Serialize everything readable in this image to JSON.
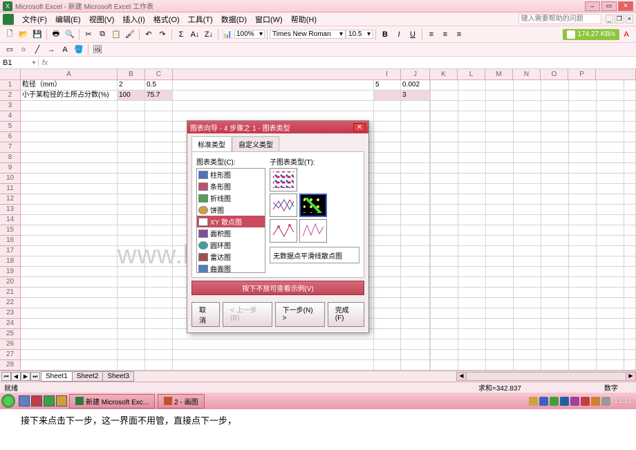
{
  "window": {
    "title": "Microsoft Excel - 新建 Microsoft Excel 工作表"
  },
  "menu": {
    "file": "文件(F)",
    "edit": "编辑(E)",
    "view": "视图(V)",
    "insert": "插入(I)",
    "format": "格式(O)",
    "tools": "工具(T)",
    "data": "数据(D)",
    "window": "窗口(W)",
    "help": "帮助(H)",
    "help_placeholder": "键入需要帮助的问题"
  },
  "toolbar": {
    "zoom": "100%",
    "font_name": "Times New Roman",
    "font_size": "10.5",
    "speed": "174.27 KB/s"
  },
  "namebox": {
    "ref": "B1"
  },
  "columns": [
    "A",
    "B",
    "C",
    "I",
    "J",
    "K",
    "L",
    "M",
    "N",
    "O",
    "P"
  ],
  "rows": {
    "r1": {
      "a": "粒径（mm）",
      "b": "2",
      "c": "0.5",
      "i": "5",
      "j": "0.002"
    },
    "r2": {
      "a": "小于某粒径的土所占分数(%)",
      "b": "100",
      "c": "75.7",
      "i": "",
      "j": "3"
    }
  },
  "dialog": {
    "title": "图表向导 - 4 步骤之 1 - 图表类型",
    "tab_standard": "标准类型",
    "tab_custom": "自定义类型",
    "left_label": "图表类型(C):",
    "right_label": "子图表类型(T):",
    "types": [
      "柱形图",
      "条形图",
      "折线图",
      "饼图",
      "XY 散点图",
      "面积图",
      "圆环图",
      "雷达图",
      "曲面图"
    ],
    "selected_type": "XY 散点图",
    "desc": "无数据点平滑线散点图",
    "sample_btn": "按下不放可查看示例(V)",
    "btn_cancel": "取消",
    "btn_back": "< 上一步(B)",
    "btn_next": "下一步(N) >",
    "btn_finish": "完成(F)"
  },
  "watermark": "www.bdocx.com",
  "sheets": {
    "s1": "Sheet1",
    "s2": "Sheet2",
    "s3": "Sheet3"
  },
  "status": {
    "ready": "就绪",
    "sum": "求和=342.837",
    "mode": "数字"
  },
  "taskbar": {
    "task1": "新建 Microsoft Exc...",
    "task2": "2 - 画图",
    "clock": "22:24"
  },
  "caption": "接下来点击下一步，这一界面不用管，直接点下一步，"
}
